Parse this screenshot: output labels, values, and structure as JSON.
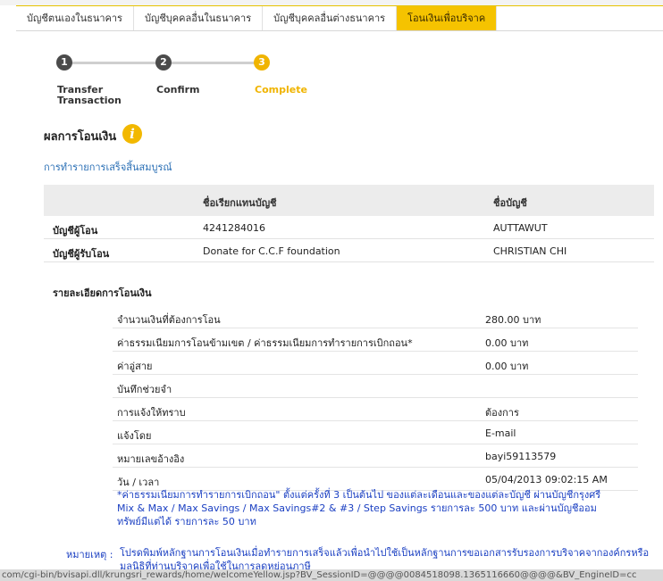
{
  "tabs": [
    {
      "label": "บัญชีตนเองในธนาคาร"
    },
    {
      "label": "บัญชีบุคคลอื่นในธนาคาร"
    },
    {
      "label": "บัญชีบุคคลอื่นต่างธนาคาร"
    },
    {
      "label": "โอนเงินเพื่อบริจาค",
      "active": true
    }
  ],
  "stepper": {
    "steps": [
      {
        "num": "1",
        "label_line1": "Transfer",
        "label_line2": "Transaction"
      },
      {
        "num": "2",
        "label_line1": "Confirm",
        "label_line2": ""
      },
      {
        "num": "3",
        "label_line1": "Complete",
        "label_line2": ""
      }
    ],
    "current": 3
  },
  "result": {
    "title": "ผลการโอนเงิน",
    "info_icon": "i",
    "message": "การทำรายการเสร็จสิ้นสมบูรณ์"
  },
  "accounts": {
    "col_nickname": "ชื่อเรียกแทนบัญชี",
    "col_name": "ชื่อบัญชี",
    "rows": [
      {
        "label": "บัญชีผู้โอน",
        "nickname": "4241284016",
        "name": "AUTTAWUT"
      },
      {
        "label": "บัญชีผู้รับโอน",
        "nickname": "Donate for C.C.F foundation",
        "name": "CHRISTIAN CHI"
      }
    ]
  },
  "details": {
    "title": "รายละเอียดการโอนเงิน",
    "rows": [
      {
        "key": "จำนวนเงินที่ต้องการโอน",
        "star": "",
        "value": "280.00 บาท"
      },
      {
        "key": "ค่าธรรมเนียมการโอนข้ามเขต / ค่าธรรมเนียมการทำรายการเบิกถอน",
        "star": "*",
        "value": "0.00 บาท"
      },
      {
        "key": "ค่าอู่สาย",
        "star": "",
        "value": "0.00 บาท"
      },
      {
        "key": "บันทึกช่วยจำ",
        "star": "",
        "value": ""
      },
      {
        "key": "การแจ้งให้ทราบ",
        "star": "",
        "value": "ต้องการ"
      },
      {
        "key": "แจ้งโดย",
        "star": "",
        "value": "E-mail"
      },
      {
        "key": "หมายเลขอ้างอิง",
        "star": "",
        "value": "bayi59113579"
      },
      {
        "key": "วัน / เวลา",
        "star": "",
        "value": "05/04/2013 09:02:15 AM"
      }
    ]
  },
  "fee_note": "*ค่าธรรมเนียมการทำรายการเบิกถอน\" ตั้งแต่ครั้งที่ 3 เป็นต้นไป ของแต่ละเดือนและของแต่ละบัญชี ผ่านบัญชีกรุงศรี Mix & Max / Max Savings / Max Savings#2 & #3 / Step Savings รายการละ 500 บาท และผ่านบัญชีออมทรัพย์มีแต่ได้ รายการละ 50 บาท",
  "remark": {
    "label": "หมายเหตุ :",
    "text": "โปรดพิมพ์หลักฐานการโอนเงินเมื่อทำรายการเสร็จแล้วเพื่อนำไปใช้เป็นหลักฐานการขอเอกสารรับรองการบริจาคจากองค์กรหรือมูลนิธิที่ท่านบริจาคเพื่อใช้ในการลดหย่อนภาษี"
  },
  "statusbar": {
    "url": "com/cgi-bin/bvisapi.dll/krungsri_rewards/home/welcomeYellow.jsp?BV_SessionID=@@@@0084518098.1365116660@@@@&BV_EngineID=cc"
  },
  "colors": {
    "accent": "#f5c300",
    "step_active": "#f0b400",
    "link_blue": "#2a6fb5",
    "note_blue": "#1a3fc2"
  }
}
